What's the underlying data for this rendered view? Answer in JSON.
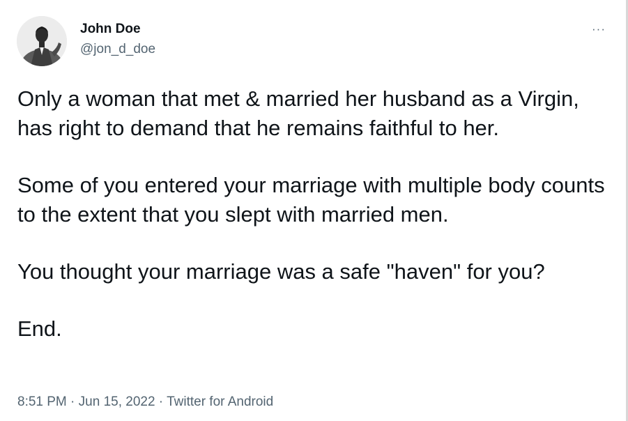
{
  "author": {
    "display_name": "John Doe",
    "handle": "@jon_d_doe",
    "avatar": "person-in-suit-photo"
  },
  "more_icon": "more-horizontal-icon",
  "more_label": "···",
  "tweet": {
    "paragraphs": [
      "Only a woman that met & married her husband as a Virgin, has right to demand that he remains faithful to her.",
      "Some of you entered your marriage with multiple body counts to the extent that you slept with married men.",
      "You thought your marriage was a safe \"haven\" for you?",
      "End."
    ]
  },
  "meta": {
    "time": "8:51 PM",
    "separator": " · ",
    "date": "Jun 15, 2022",
    "source": "Twitter for Android"
  },
  "colors": {
    "text_primary": "#0f1419",
    "text_secondary": "#536471",
    "background": "#ffffff"
  }
}
